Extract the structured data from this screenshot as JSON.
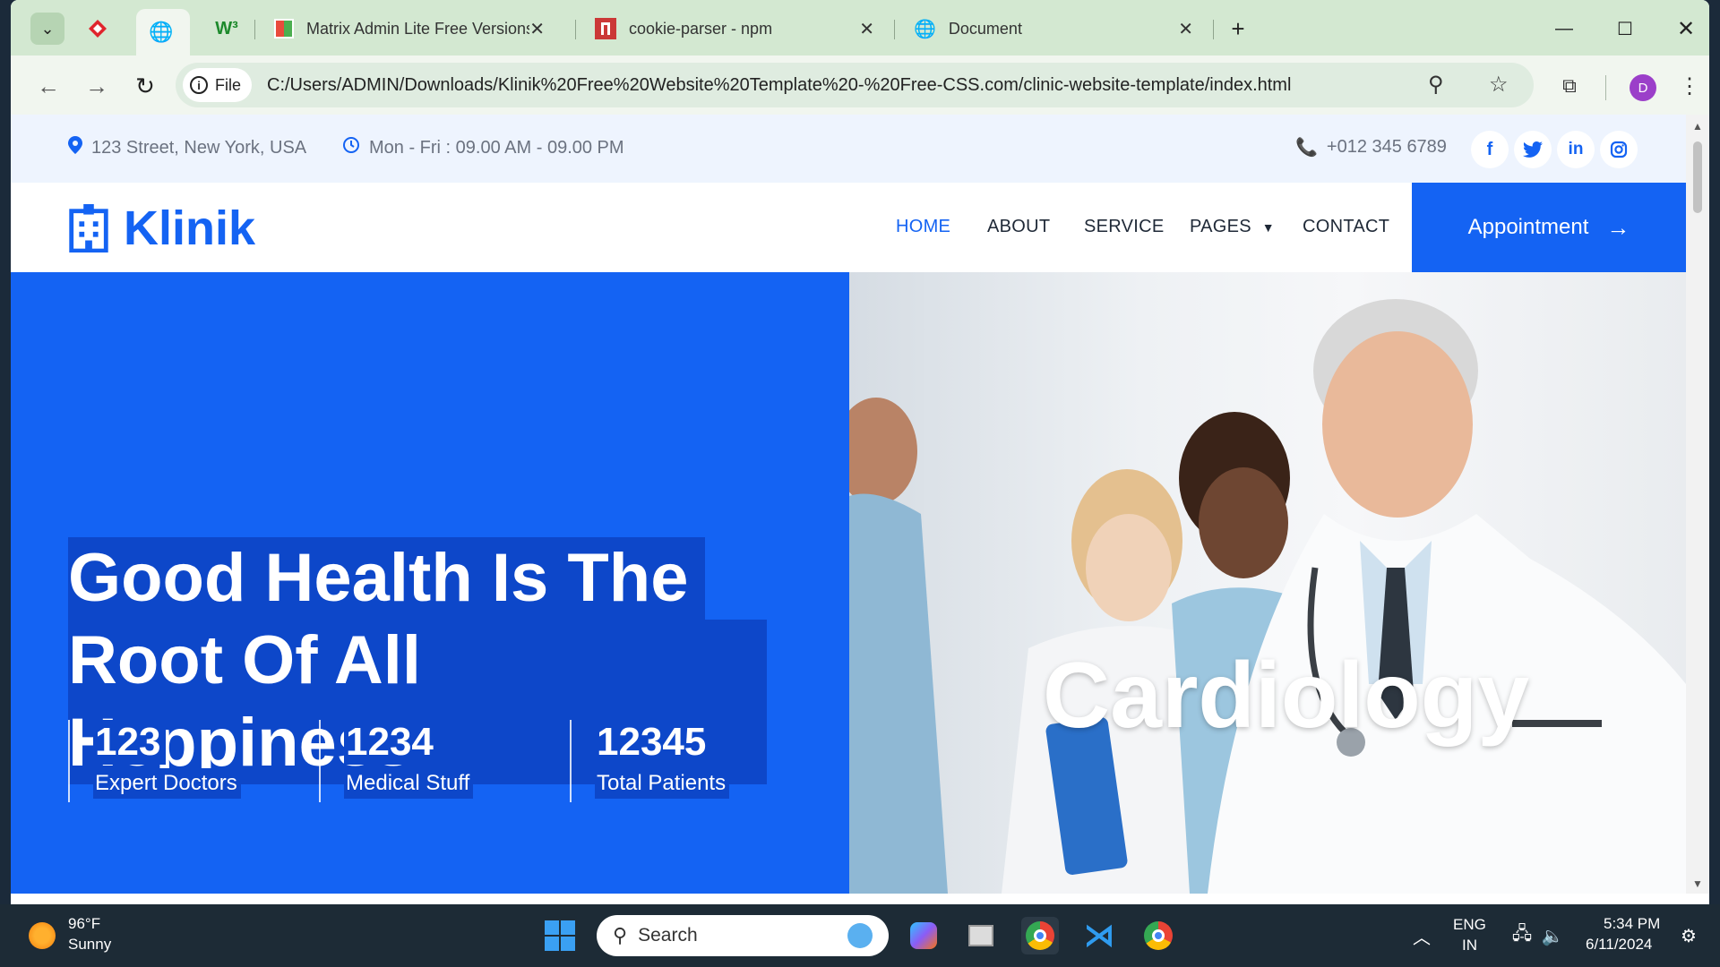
{
  "browser": {
    "tabs": [
      {
        "title": "Matrix Admin Lite Free Versions"
      },
      {
        "title": "cookie-parser - npm"
      },
      {
        "title": "Document"
      }
    ],
    "address": {
      "chip_label": "File",
      "url": "C:/Users/ADMIN/Downloads/Klinik%20Free%20Website%20Template%20-%20Free-CSS.com/clinic-website-template/index.html"
    },
    "profile_initial": "D"
  },
  "site": {
    "topbar": {
      "address": "123 Street, New York, USA",
      "hours": "Mon - Fri : 09.00 AM - 09.00 PM",
      "phone": "+012 345 6789",
      "social": [
        "f",
        "t",
        "in",
        "ig"
      ]
    },
    "brand": "Klinik",
    "menu": {
      "home": "HOME",
      "about": "ABOUT",
      "service": "SERVICE",
      "pages": "PAGES",
      "contact": "CONTACT"
    },
    "cta": "Appointment",
    "hero": {
      "line1": "Good Health Is The",
      "line2": "Root Of All Heppiness",
      "stats": [
        {
          "value": "123",
          "label": "Expert Doctors"
        },
        {
          "value": "1234",
          "label": "Medical Stuff"
        },
        {
          "value": "12345",
          "label": "Total Patients"
        }
      ],
      "caption": "Cardiology"
    }
  },
  "taskbar": {
    "weather_temp": "96°F",
    "weather_desc": "Sunny",
    "search_placeholder": "Search",
    "lang": "ENG",
    "region": "IN",
    "time": "5:34 PM",
    "date": "6/11/2024"
  },
  "colors": {
    "brand": "#1463f3",
    "highlight": "#0d47c9",
    "tabbar": "#d3e8d1"
  }
}
